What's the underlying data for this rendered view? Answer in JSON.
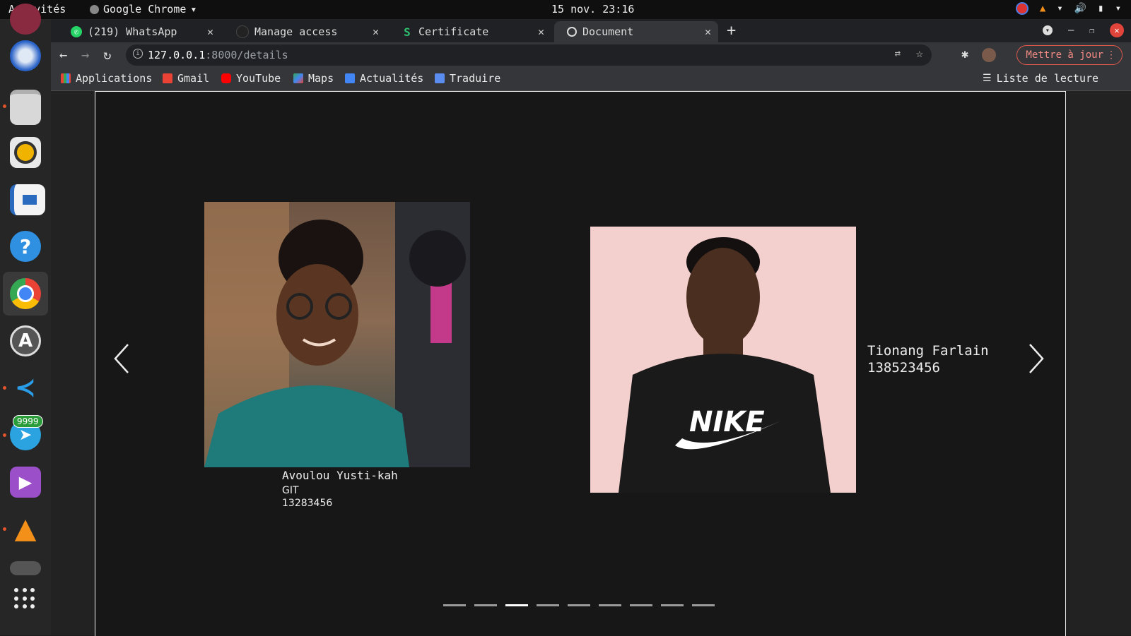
{
  "topbar": {
    "activities": "Activités",
    "app_name": "Google Chrome",
    "clock": "15 nov. 23:16"
  },
  "tabs": [
    {
      "title": "(219) WhatsApp",
      "icon": "whatsapp-icon"
    },
    {
      "title": "Manage access",
      "icon": "github-icon"
    },
    {
      "title": "Certificate",
      "icon": "s-icon"
    },
    {
      "title": "Document",
      "icon": "globe-icon",
      "active": true
    }
  ],
  "toolbar": {
    "url_host": "127.0.0.1",
    "url_rest": ":8000/details",
    "update_label": "Mettre à jour"
  },
  "bookmarks": {
    "items": [
      "Applications",
      "Gmail",
      "YouTube",
      "Maps",
      "Actualités",
      "Traduire"
    ],
    "reading_list": "Liste de lecture"
  },
  "dock": {
    "telegram_badge": "9999"
  },
  "carousel": {
    "slides": [
      {
        "name": "Avoulou Yusti-kah",
        "dept": "GIT",
        "id": "13283456"
      },
      {
        "name": "Tionang Farlain",
        "id": "138523456"
      }
    ],
    "indicator_count": 9,
    "active_indicator": 3
  },
  "colors": {
    "accent_update": "#e0584b",
    "page_bg": "#171717"
  }
}
